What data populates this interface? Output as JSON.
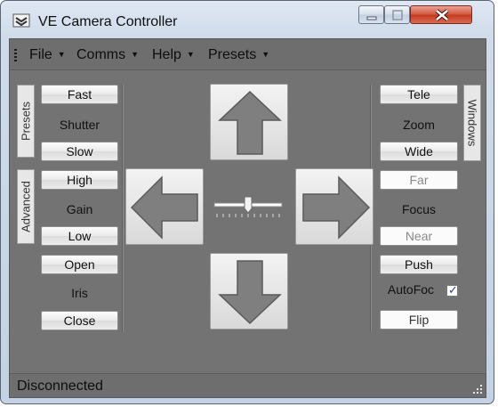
{
  "window": {
    "title": "VE Camera Controller"
  },
  "menu": {
    "items": [
      {
        "label": "File"
      },
      {
        "label": "Comms"
      },
      {
        "label": "Help"
      },
      {
        "label": "Presets"
      }
    ]
  },
  "tabs": {
    "presets": "Presets",
    "advanced": "Advanced",
    "windows": "Windows"
  },
  "shutter": {
    "fast": "Fast",
    "label": "Shutter",
    "slow": "Slow"
  },
  "gain": {
    "high": "High",
    "label": "Gain",
    "low": "Low"
  },
  "iris": {
    "open": "Open",
    "label": "Iris",
    "close": "Close"
  },
  "zoom": {
    "tele": "Tele",
    "label": "Zoom",
    "wide": "Wide"
  },
  "focus": {
    "far": "Far",
    "label": "Focus",
    "near": "Near"
  },
  "push": {
    "label": "Push"
  },
  "autofocus": {
    "label": "AutoFoc",
    "checked": true,
    "mark": "✓"
  },
  "flip": {
    "label": "Flip"
  },
  "speed_slider": {
    "value_fraction": 0.5
  },
  "status": {
    "text": "Disconnected"
  },
  "icons": {
    "app": "camera-icon",
    "minimize": "minimize-icon",
    "maximize": "maximize-icon",
    "close": "close-icon"
  },
  "colors": {
    "panel": "#737373",
    "close_button": "#c23b22",
    "checkmark": "#2f3f9a"
  }
}
